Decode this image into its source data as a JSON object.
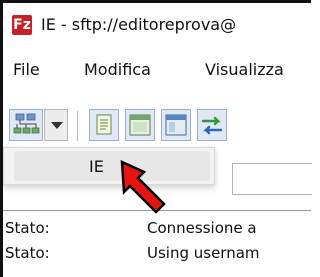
{
  "window": {
    "title": "IE - sftp://editoreprova@",
    "app_icon_glyph": "Fz"
  },
  "menu": {
    "items": [
      {
        "label": "File"
      },
      {
        "label": "Modifica"
      },
      {
        "label": "Visualizza"
      }
    ]
  },
  "toolbar": {
    "buttons": [
      {
        "icon": "site-manager-icon"
      },
      {
        "icon": "chevron-down-icon"
      },
      {
        "icon": "message-log-icon"
      },
      {
        "icon": "local-tree-icon"
      },
      {
        "icon": "remote-tree-icon"
      },
      {
        "icon": "transfer-queue-icon"
      }
    ]
  },
  "site_dropdown": {
    "items": [
      {
        "label": "IE"
      }
    ]
  },
  "message_log": {
    "rows": [
      {
        "label": "Stato:",
        "message": "Connessione a"
      },
      {
        "label": "Stato:",
        "message": "Using usernam"
      }
    ]
  },
  "annotation": {
    "pointer_color": "#e8150f"
  }
}
